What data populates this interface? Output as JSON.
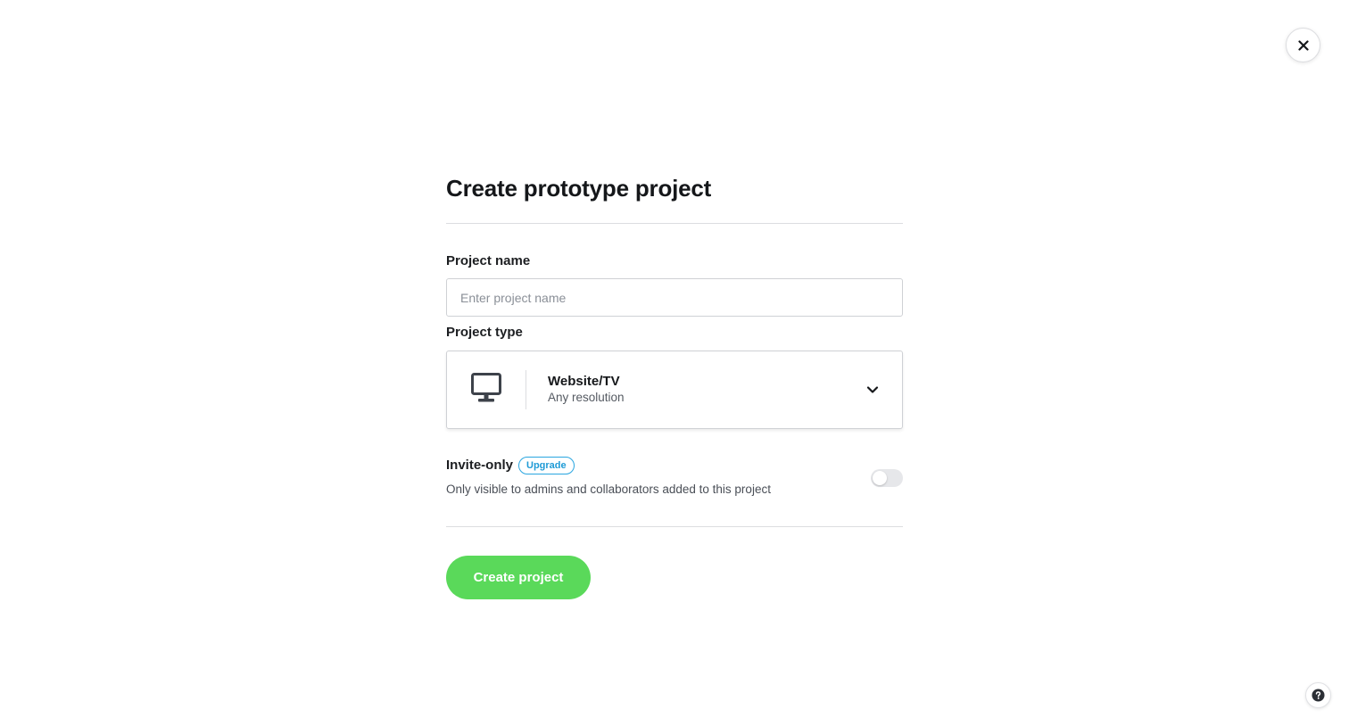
{
  "page": {
    "title": "Create prototype project"
  },
  "project_name": {
    "label": "Project name",
    "placeholder": "Enter project name",
    "value": ""
  },
  "project_type": {
    "label": "Project type",
    "selected_title": "Website/TV",
    "selected_subtitle": "Any resolution",
    "icon": "desktop-monitor-icon"
  },
  "invite_only": {
    "label": "Invite-only",
    "badge": "Upgrade",
    "description": "Only visible to admins and collaborators added to this project",
    "enabled": false
  },
  "actions": {
    "create_label": "Create project"
  },
  "icons": {
    "close": "close-icon",
    "help": "help-icon",
    "dropdown": "chevron-down-icon"
  },
  "colors": {
    "primary_button": "#5ad95a",
    "badge_accent": "#1f9bd6",
    "text_dark": "#15171a"
  }
}
